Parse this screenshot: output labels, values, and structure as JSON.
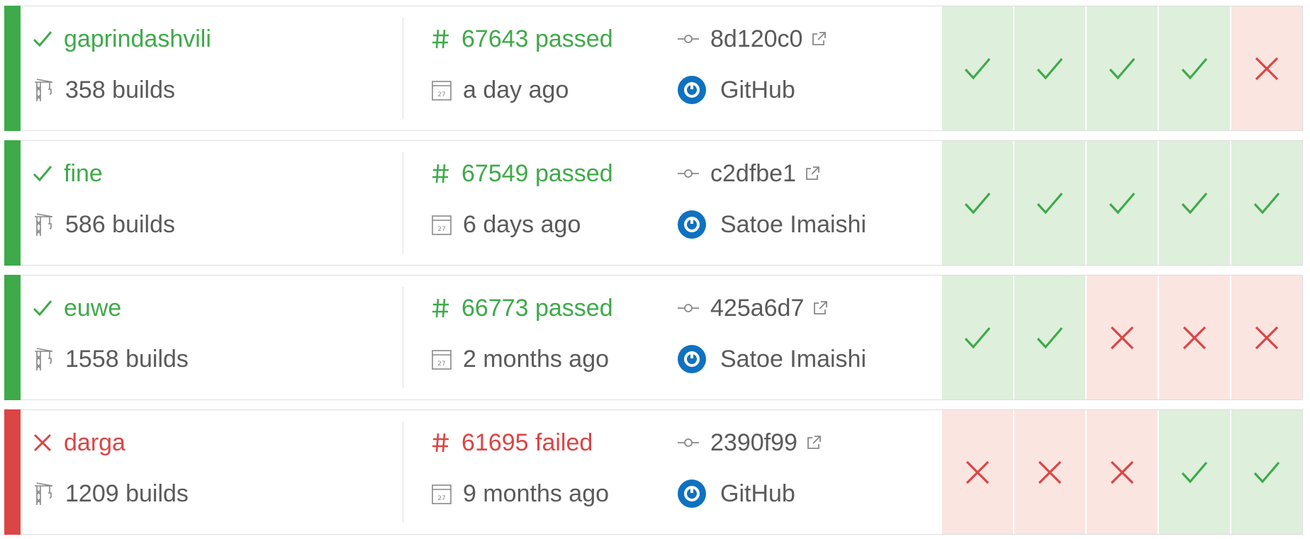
{
  "builds": [
    {
      "state": "passed",
      "branch": "gaprindashvili",
      "builds_count": "358 builds",
      "build_status": "67643 passed",
      "time_ago": "a day ago",
      "commit": "8d120c0",
      "author": "GitHub",
      "jobs": [
        "pass",
        "pass",
        "pass",
        "pass",
        "fail"
      ]
    },
    {
      "state": "passed",
      "branch": "fine",
      "builds_count": "586 builds",
      "build_status": "67549 passed",
      "time_ago": "6 days ago",
      "commit": "c2dfbe1",
      "author": "Satoe Imaishi",
      "jobs": [
        "pass",
        "pass",
        "pass",
        "pass",
        "pass"
      ]
    },
    {
      "state": "passed",
      "branch": "euwe",
      "builds_count": "1558 builds",
      "build_status": "66773 passed",
      "time_ago": "2 months ago",
      "commit": "425a6d7",
      "author": "Satoe Imaishi",
      "jobs": [
        "pass",
        "pass",
        "fail",
        "fail",
        "fail"
      ]
    },
    {
      "state": "failed",
      "branch": "darga",
      "builds_count": "1209 builds",
      "build_status": "61695 failed",
      "time_ago": "9 months ago",
      "commit": "2390f99",
      "author": "GitHub",
      "jobs": [
        "fail",
        "fail",
        "fail",
        "pass",
        "pass"
      ]
    }
  ],
  "icons": {
    "passed": "check-icon",
    "failed": "cross-icon",
    "builds": "crane-icon",
    "number": "hash-icon",
    "date": "calendar-icon",
    "commit": "commit-icon",
    "external": "external-link-icon",
    "avatar": "avatar-icon"
  },
  "colors": {
    "passed": "#3eaa49",
    "failed": "#db4545",
    "pass_cell": "#deefdc",
    "fail_cell": "#fbe5e1",
    "avatar": "#0f72c0"
  }
}
